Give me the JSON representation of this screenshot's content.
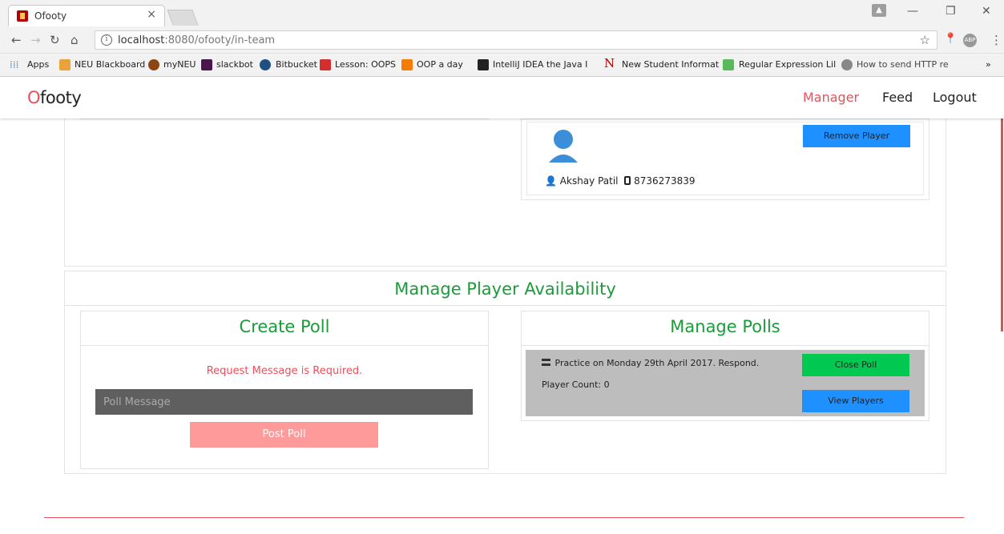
{
  "browser": {
    "tab_title": "Ofooty",
    "tab_close": "×",
    "url_host": "localhost",
    "url_rest": ":8080/ofooty/in-team",
    "profile_glyph": "▲",
    "bookmarks": [
      {
        "label": "Apps",
        "color": "#4285f4"
      },
      {
        "label": "NEU Blackboard",
        "color": "#e8a33d"
      },
      {
        "label": "myNEU",
        "color": "#8b4513"
      },
      {
        "label": "slackbot",
        "color": "#4a154b"
      },
      {
        "label": "Bitbucket",
        "color": "#205081"
      },
      {
        "label": "Lesson: OOPS",
        "color": "#d32f2f"
      },
      {
        "label": "OOP a day",
        "color": "#f57c00"
      },
      {
        "label": "IntelliJ IDEA the Java I",
        "color": "#222222"
      },
      {
        "label": "New Student Informat",
        "color": "#c00000"
      },
      {
        "label": "Regular Expression Lil",
        "color": "#5cb85c"
      },
      {
        "label": "How to send HTTP re",
        "color": "#888888"
      }
    ],
    "bookmarks_more": "»"
  },
  "nav": {
    "logo_o": "O",
    "logo_rest": "footy",
    "links": [
      "Manager",
      "Feed",
      "Logout"
    ]
  },
  "player": {
    "remove_label": "Remove Player",
    "name": "Akshay Patil",
    "phone": "8736273839"
  },
  "availability": {
    "title": "Manage Player Availability",
    "create_poll": {
      "title": "Create Poll",
      "error": "Request Message is Required.",
      "placeholder": "Poll Message",
      "post_label": "Post Poll"
    },
    "manage_polls": {
      "title": "Manage Polls",
      "poll_text": "Practice on Monday 29th April 2017. Respond.",
      "player_count": "Player Count: 0",
      "close_label": "Close Poll",
      "view_label": "View Players"
    }
  },
  "colors": {
    "accent": "#e8505b",
    "title_green": "#1a9c3a",
    "button_blue": "#1e90ff",
    "button_green": "#00c851"
  }
}
